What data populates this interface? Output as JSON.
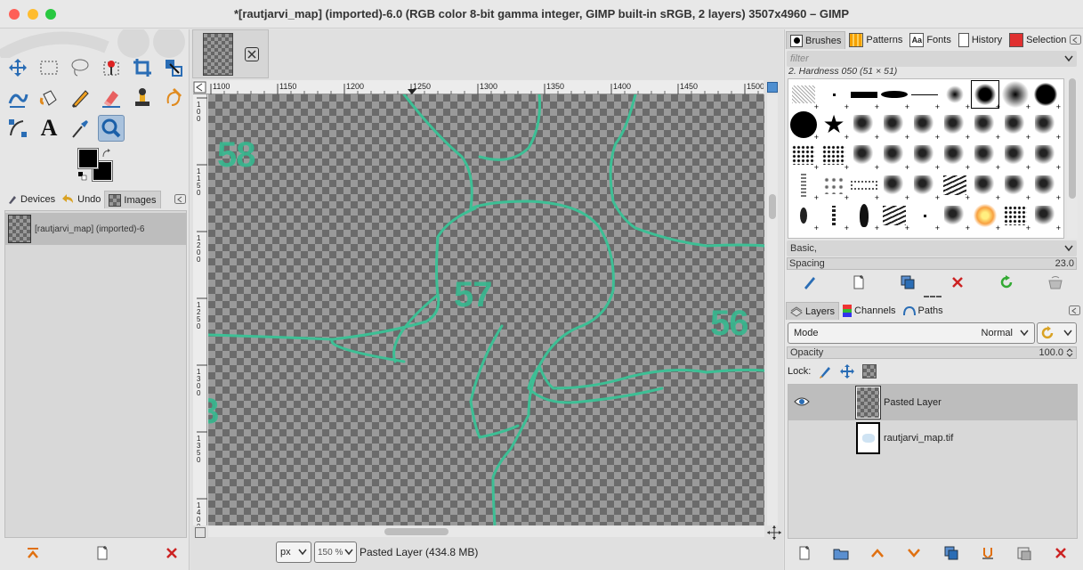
{
  "window": {
    "title": "*[rautjarvi_map] (imported)-6.0 (RGB color 8-bit gamma integer, GIMP built-in sRGB, 2 layers) 3507x4960 – GIMP",
    "close_color": "#fe5f57",
    "minimize_color": "#febc2e",
    "maximize_color": "#28c840"
  },
  "toolbox": {
    "tools": [
      "move-tool",
      "rect-select-tool",
      "free-select-tool",
      "fuzzy-select-tool",
      "crop-tool",
      "transform-tool",
      "warp-tool",
      "fill-tool",
      "paintbrush-tool",
      "eraser-tool",
      "clone-tool",
      "smudge-tool",
      "paths-tool",
      "text-tool",
      "color-picker-tool",
      "zoom-tool"
    ],
    "fg_color": "#000000",
    "bg_color": "#000000"
  },
  "left_dock": {
    "tabs": [
      "Devices",
      "Undo",
      "Images"
    ],
    "image_item": "[rautjarvi_map] (imported)-6"
  },
  "image_tab": {
    "label": "close"
  },
  "ruler": {
    "ticks": [
      "1100",
      "1150",
      "1200",
      "1250",
      "1300",
      "1350",
      "1400",
      "1450",
      "1500"
    ],
    "vticks": [
      "1 0 0",
      "1 1 5 0",
      "1 2 0 0",
      "1 2 5 0",
      "1 3 0 0",
      "1 3 5 0",
      "1 4 0 0"
    ]
  },
  "canvas": {
    "labels": [
      "58",
      "57",
      "56",
      "3"
    ],
    "line_color": "#3dbf95"
  },
  "statusbar": {
    "unit": "px",
    "zoom": "150 %",
    "layer_info": "Pasted Layer (434.8 MB)"
  },
  "brushes": {
    "tabs": [
      "Brushes",
      "Patterns",
      "Fonts",
      "History",
      "Selection"
    ],
    "filter_placeholder": "filter",
    "current_brush": "2. Hardness 050 (51 × 51)",
    "tag": "Basic,",
    "spacing_label": "Spacing",
    "spacing_value": "23.0"
  },
  "layers": {
    "tabs": [
      "Layers",
      "Channels",
      "Paths"
    ],
    "mode_label": "Mode",
    "mode_value": "Normal",
    "opacity_label": "Opacity",
    "opacity_value": "100.0",
    "lock_label": "Lock:",
    "items": [
      {
        "name": "Pasted Layer",
        "visible": true,
        "selected": true
      },
      {
        "name": "rautjarvi_map.tif",
        "visible": false,
        "selected": false
      }
    ]
  }
}
